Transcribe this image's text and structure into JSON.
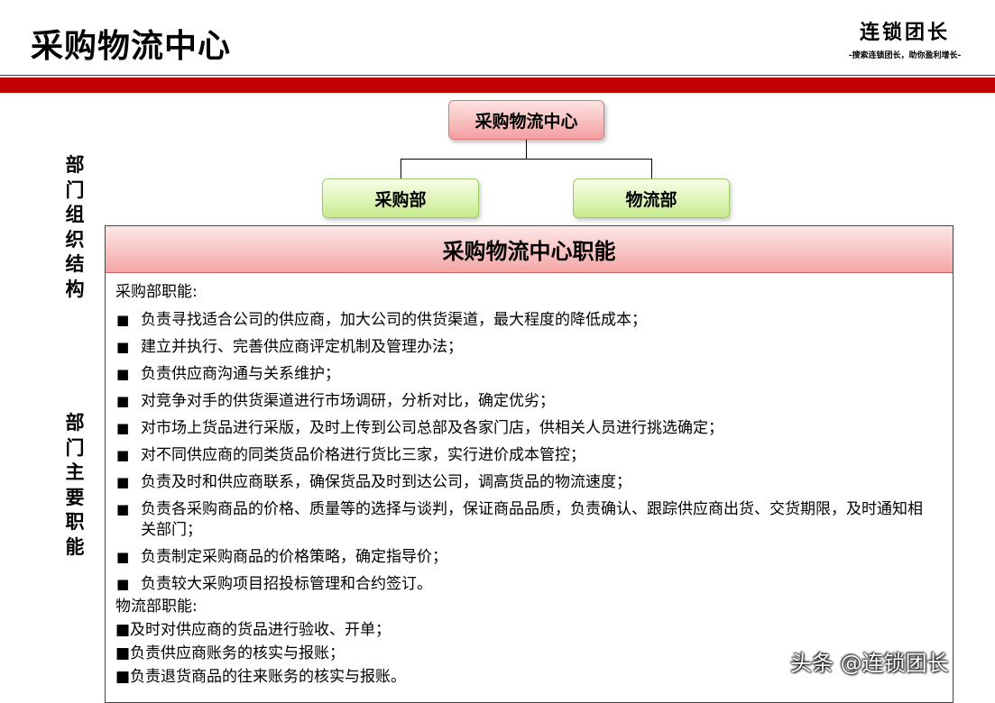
{
  "header": {
    "title": "采购物流中心",
    "brand_name": "连锁团长",
    "brand_slogan": "-搜索连锁团长，助你盈利增长-",
    "accent_color": "#c00000"
  },
  "org_chart": {
    "root": "采购物流中心",
    "children": [
      "采购部",
      "物流部"
    ]
  },
  "side_labels": {
    "structure": [
      "部",
      "门",
      "组",
      "织",
      "结",
      "构"
    ],
    "functions": [
      "部",
      "门",
      "主",
      "要",
      "职",
      "能"
    ]
  },
  "panel": {
    "title": "采购物流中心职能",
    "procurement": {
      "label": "采购部职能:",
      "items": [
        "负责寻找适合公司的供应商，加大公司的供货渠道，最大程度的降低成本；",
        "建立并执行、完善供应商评定机制及管理办法；",
        "负责供应商沟通与关系维护；",
        "对竞争对手的供货渠道进行市场调研，分析对比，确定优劣；",
        "对市场上货品进行采版，及时上传到公司总部及各家门店，供相关人员进行挑选确定；",
        "对不同供应商的同类货品价格进行货比三家，实行进价成本管控；",
        "负责及时和供应商联系，确保货品及时到达公司，调高货品的物流速度；",
        "负责各采购商品的价格、质量等的选择与谈判，保证商品品质，负责确认、跟踪供应商出货、交货期限，及时通知相关部门；",
        "负责制定采购商品的价格策略，确定指导价；",
        "负责较大采购项目招投标管理和合约签订。"
      ]
    },
    "logistics": {
      "label": "物流部职能:",
      "items": [
        "■及时对供应商的货品进行验收、开单；",
        "■负责供应商账务的核实与报账；",
        "■负责退货商品的往来账务的核实与报账。"
      ]
    }
  },
  "watermark": "头条 @连锁团长"
}
